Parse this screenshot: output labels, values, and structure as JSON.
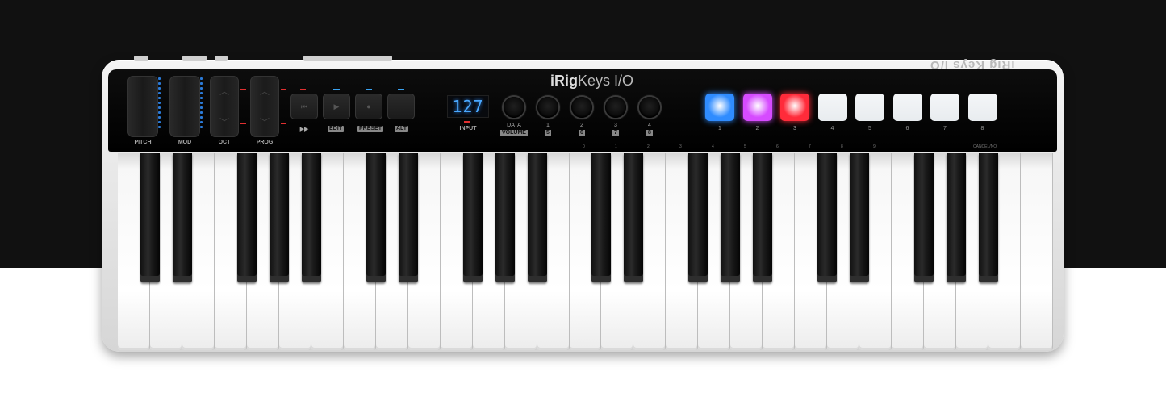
{
  "device": {
    "brand_prefix": "iRig",
    "brand_suffix": "Keys I/O",
    "rear_logo": "iRig Keys I/O"
  },
  "controls": {
    "pitch_label": "PITCH",
    "mod_label": "MOD",
    "oct_label": "OCT",
    "prog_label": "PROG",
    "transport_label": "▶▶",
    "edit_label": "EDIT",
    "preset_label": "PRESET",
    "alt_label": "ALT",
    "display_value": "127",
    "input_label": "INPUT",
    "knob_labels": [
      {
        "top": "DATA",
        "bottom": "VOLUME"
      },
      {
        "top": "1",
        "bottom": "5"
      },
      {
        "top": "2",
        "bottom": "6"
      },
      {
        "top": "3",
        "bottom": "7"
      },
      {
        "top": "4",
        "bottom": "8"
      }
    ]
  },
  "pads": [
    {
      "label": "1",
      "color": "#2f8cff"
    },
    {
      "label": "2",
      "color": "#d64bff"
    },
    {
      "label": "3",
      "color": "#ff2b3a"
    },
    {
      "label": "4",
      "color": "#e8ecef"
    },
    {
      "label": "5",
      "color": "#e8ecef"
    },
    {
      "label": "6",
      "color": "#e8ecef"
    },
    {
      "label": "7",
      "color": "#e8ecef"
    },
    {
      "label": "8",
      "color": "#e8ecef"
    }
  ],
  "note_marks": [
    "0",
    "1",
    "2",
    "3",
    "4",
    "5",
    "6",
    "7",
    "8",
    "9",
    "CANCEL/NO"
  ],
  "keyboard": {
    "white_keys": 29,
    "colors": {
      "white": "#ffffff",
      "black": "#111111",
      "background_top": "#111111"
    }
  }
}
